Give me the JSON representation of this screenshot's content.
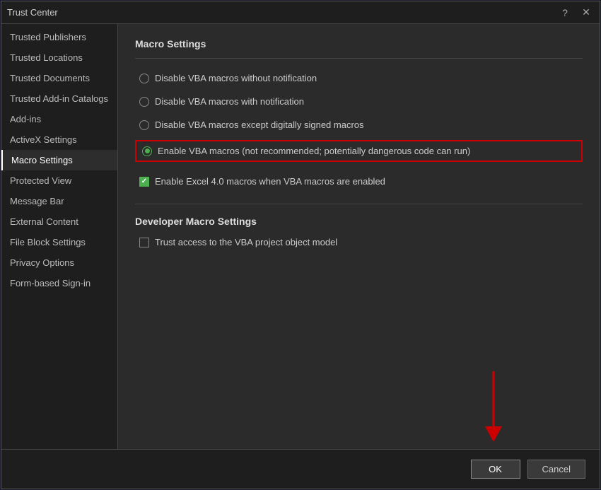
{
  "dialog": {
    "title": "Trust Center",
    "help_icon": "?",
    "close_icon": "✕"
  },
  "sidebar": {
    "items": [
      {
        "id": "trusted-publishers",
        "label": "Trusted Publishers",
        "active": false
      },
      {
        "id": "trusted-locations",
        "label": "Trusted Locations",
        "active": false
      },
      {
        "id": "trusted-documents",
        "label": "Trusted Documents",
        "active": false
      },
      {
        "id": "trusted-add-in-catalogs",
        "label": "Trusted Add-in Catalogs",
        "active": false
      },
      {
        "id": "add-ins",
        "label": "Add-ins",
        "active": false
      },
      {
        "id": "activex-settings",
        "label": "ActiveX Settings",
        "active": false
      },
      {
        "id": "macro-settings",
        "label": "Macro Settings",
        "active": true
      },
      {
        "id": "protected-view",
        "label": "Protected View",
        "active": false
      },
      {
        "id": "message-bar",
        "label": "Message Bar",
        "active": false
      },
      {
        "id": "external-content",
        "label": "External Content",
        "active": false
      },
      {
        "id": "file-block-settings",
        "label": "File Block Settings",
        "active": false
      },
      {
        "id": "privacy-options",
        "label": "Privacy Options",
        "active": false
      },
      {
        "id": "form-based-sign-in",
        "label": "Form-based Sign-in",
        "active": false
      }
    ]
  },
  "main": {
    "section_title": "Macro Settings",
    "radio_options": [
      {
        "id": "disable-no-notify",
        "label": "Disable VBA macros without notification",
        "selected": false
      },
      {
        "id": "disable-with-notify",
        "label": "Disable VBA macros with notification",
        "selected": false
      },
      {
        "id": "disable-except-signed",
        "label": "Disable VBA macros except digitally signed macros",
        "selected": false
      },
      {
        "id": "enable-vba",
        "label": "Enable VBA macros (not recommended; potentially dangerous code can run)",
        "selected": true,
        "highlighted": true
      }
    ],
    "checkbox_excel4": {
      "label": "Enable Excel 4.0 macros when VBA macros are enabled",
      "checked": true
    },
    "dev_section_title": "Developer Macro Settings",
    "checkbox_trust_vba": {
      "label": "Trust access to the VBA project object model",
      "checked": false
    }
  },
  "footer": {
    "ok_label": "OK",
    "cancel_label": "Cancel"
  }
}
